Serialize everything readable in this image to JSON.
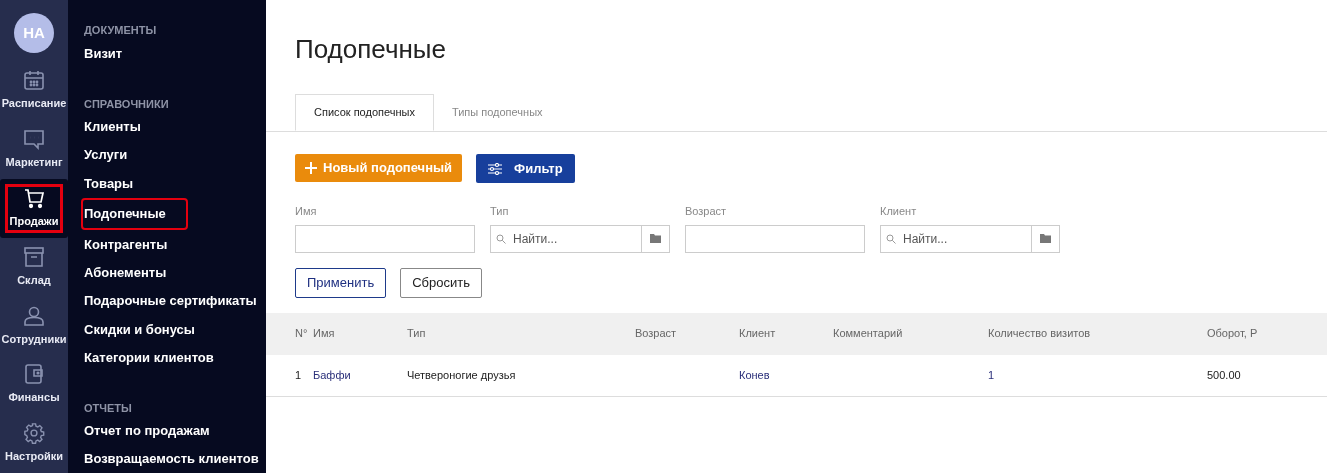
{
  "user": {
    "initials": "НА"
  },
  "nav": [
    {
      "label": "Расписание",
      "kind": "calendar",
      "selected": false,
      "highlighted": false
    },
    {
      "label": "Маркетинг",
      "kind": "chat",
      "selected": false,
      "highlighted": false
    },
    {
      "label": "Продажи",
      "kind": "cart",
      "selected": true,
      "highlighted": true
    },
    {
      "label": "Склад",
      "kind": "box",
      "selected": false,
      "highlighted": false
    },
    {
      "label": "Сотрудники",
      "kind": "person",
      "selected": false,
      "highlighted": false
    },
    {
      "label": "Финансы",
      "kind": "wallet",
      "selected": false,
      "highlighted": false
    },
    {
      "label": "Настройки",
      "kind": "gear",
      "selected": false,
      "highlighted": false
    }
  ],
  "submenu": [
    {
      "heading": "ДОКУМЕНТЫ",
      "items": [
        {
          "label": "Визит",
          "highlighted": false
        }
      ]
    },
    {
      "heading": "СПРАВОЧНИКИ",
      "items": [
        {
          "label": "Клиенты",
          "highlighted": false
        },
        {
          "label": "Услуги",
          "highlighted": false
        },
        {
          "label": "Товары",
          "highlighted": false
        },
        {
          "label": "Подопечные",
          "highlighted": true
        },
        {
          "label": "Контрагенты",
          "highlighted": false
        },
        {
          "label": "Абонементы",
          "highlighted": false
        },
        {
          "label": "Подарочные сертификаты",
          "highlighted": false
        },
        {
          "label": "Скидки и бонусы",
          "highlighted": false
        },
        {
          "label": "Категории клиентов",
          "highlighted": false
        }
      ]
    },
    {
      "heading": "ОТЧЕТЫ",
      "items": [
        {
          "label": "Отчет по продажам",
          "highlighted": false
        },
        {
          "label": "Возвращаемость клиентов",
          "highlighted": false
        }
      ]
    }
  ],
  "page_title": "Подопечные",
  "tabs": [
    {
      "label": "Список подопечных",
      "selected": true
    },
    {
      "label": "Типы подопечных",
      "selected": false
    }
  ],
  "actions": {
    "new": "Новый подопечный",
    "filter": "Фильтр"
  },
  "filters": [
    {
      "label": "Имя",
      "kind": "text"
    },
    {
      "label": "Тип",
      "kind": "lookup",
      "placeholder": "Найти..."
    },
    {
      "label": "Возраст",
      "kind": "text"
    },
    {
      "label": "Клиент",
      "kind": "lookup",
      "placeholder": "Найти..."
    }
  ],
  "filter_buttons": {
    "apply": "Применить",
    "reset": "Сбросить"
  },
  "table": {
    "columns": [
      "N°",
      "Имя",
      "Тип",
      "Возраст",
      "Клиент",
      "Комментарий",
      "Количество визитов",
      "Оборот, Р"
    ],
    "rows": [
      [
        "1",
        "Баффи",
        "Четвероногие друзья",
        "",
        "Конев",
        "",
        "1",
        "500.00"
      ]
    ]
  }
}
